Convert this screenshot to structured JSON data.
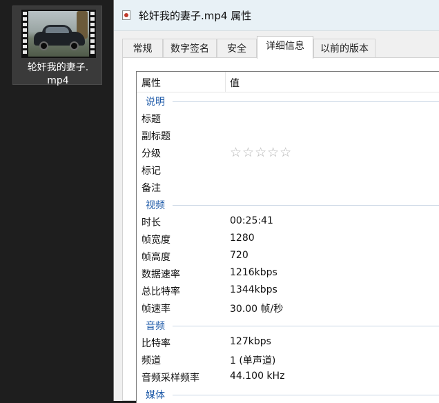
{
  "desktop": {
    "file_name_line1": "轮奸我的妻子.",
    "file_name_line2": "mp4"
  },
  "window": {
    "title": "轮奸我的妻子.mp4 属性",
    "tabs": [
      "常规",
      "数字签名",
      "安全",
      "详细信息",
      "以前的版本"
    ],
    "active_tab": "详细信息"
  },
  "details": {
    "col_property": "属性",
    "col_value": "值",
    "group_description": "说明",
    "title_label": "标题",
    "subtitle_label": "副标题",
    "rating_label": "分级",
    "rating_stars": "☆☆☆☆☆",
    "rating_value": 0,
    "tags_label": "标记",
    "comments_label": "备注",
    "group_video": "视频",
    "duration_label": "时长",
    "duration_value": "00:25:41",
    "frame_width_label": "帧宽度",
    "frame_width_value": "1280",
    "frame_height_label": "帧高度",
    "frame_height_value": "720",
    "data_rate_label": "数据速率",
    "data_rate_value": "1216kbps",
    "total_bitrate_label": "总比特率",
    "total_bitrate_value": "1344kbps",
    "frame_rate_label": "帧速率",
    "frame_rate_value": "30.00 帧/秒",
    "group_audio": "音频",
    "audio_bitrate_label": "比特率",
    "audio_bitrate_value": "127kbps",
    "channels_label": "频道",
    "channels_value": "1 (单声道)",
    "sample_rate_label": "音频采样频率",
    "sample_rate_value": "44.100 kHz",
    "group_media": "媒体"
  },
  "icons": {
    "file": "video-file-thumbnail-icon",
    "title": "media-file-icon",
    "rating": "star-outline-icon"
  },
  "colors": {
    "group_header": "#1e5aa8",
    "titlebar": "#e8f1f6",
    "desktop": "#1e1e1e"
  }
}
